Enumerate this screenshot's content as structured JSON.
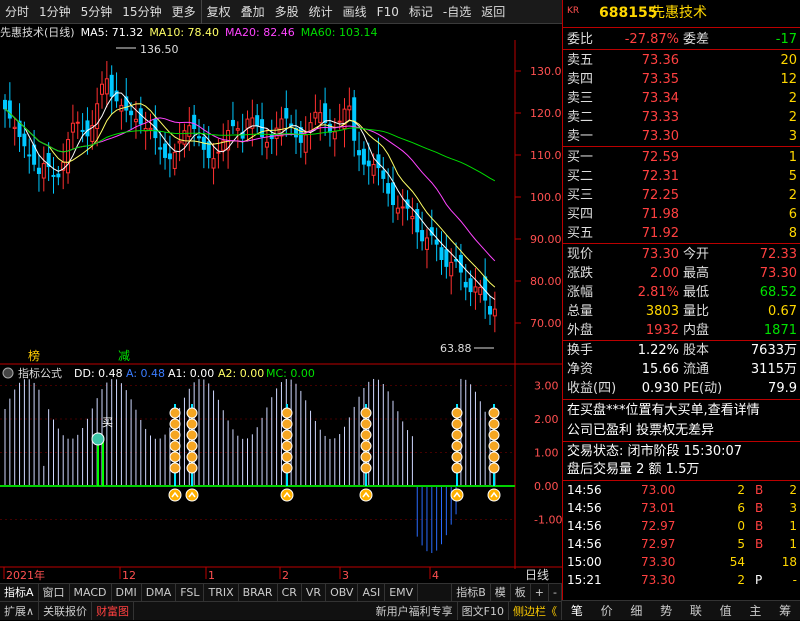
{
  "toolbar": {
    "items": [
      "分时",
      "1分钟",
      "5分钟",
      "15分钟",
      "更多",
      "复权",
      "叠加",
      "多股",
      "统计",
      "画线",
      "F10",
      "标记",
      "-自选",
      "返回"
    ]
  },
  "main_chart": {
    "title": "先惠技术(日线)",
    "ma5": "MA5: 71.32",
    "ma10": "MA10: 78.40",
    "ma20": "MA20: 82.46",
    "ma60": "MA60: 103.14",
    "high_label": "136.50",
    "low_label": "63.88",
    "y_ticks": [
      "130.0",
      "120.0",
      "110.0",
      "100.0",
      "90.00",
      "80.00",
      "70.00"
    ],
    "markers": [
      "榜",
      "减"
    ],
    "colors": {
      "up": "#ff3030",
      "down": "#00c8ff",
      "ma5": "#ffffff",
      "ma10": "#ffff66",
      "ma20": "#ff44ff",
      "ma60": "#00dd00"
    }
  },
  "indicator": {
    "name": "指标公式",
    "dd": "DD: 0.48",
    "a": "A: 0.48",
    "a1": "A1: 0.00",
    "a2": "A2: 0.00",
    "mc": "MC: 0.00",
    "y_ticks": [
      "3.00",
      "2.00",
      "1.00",
      "0.00",
      "-1.00"
    ],
    "buy_label": "买"
  },
  "x_axis": {
    "labels": [
      "2021年",
      "12",
      "1",
      "2",
      "3",
      "4"
    ],
    "period": "日线"
  },
  "bottom_tabs": [
    "指标A",
    "窗口",
    "MACD",
    "DMI",
    "DMA",
    "FSL",
    "TRIX",
    "BRAR",
    "CR",
    "VR",
    "OBV",
    "ASI",
    "EMV",
    "",
    "指标B",
    "模",
    "板",
    "+",
    "-"
  ],
  "status_bar": {
    "left": [
      "扩展∧",
      "关联报价",
      "财富图"
    ],
    "right": [
      "新用户福利专享",
      "图文F10",
      "侧边栏《"
    ]
  },
  "quote": {
    "market_tag": "KR",
    "code": "688155",
    "name": "先惠技术",
    "ratio_label": "委比",
    "ratio": "-27.87%",
    "diff_label": "委差",
    "diff": "-17",
    "asks": [
      {
        "label": "卖五",
        "price": "73.36",
        "vol": "20"
      },
      {
        "label": "卖四",
        "price": "73.35",
        "vol": "12"
      },
      {
        "label": "卖三",
        "price": "73.34",
        "vol": "2"
      },
      {
        "label": "卖二",
        "price": "73.33",
        "vol": "2"
      },
      {
        "label": "卖一",
        "price": "73.30",
        "vol": "3"
      }
    ],
    "bids": [
      {
        "label": "买一",
        "price": "72.59",
        "vol": "1"
      },
      {
        "label": "买二",
        "price": "72.31",
        "vol": "5"
      },
      {
        "label": "买三",
        "price": "72.25",
        "vol": "2"
      },
      {
        "label": "买四",
        "price": "71.98",
        "vol": "6"
      },
      {
        "label": "买五",
        "price": "71.92",
        "vol": "8"
      }
    ],
    "stats": [
      {
        "l1": "现价",
        "v1": "73.30",
        "c1": "red",
        "l2": "今开",
        "v2": "72.33",
        "c2": "red"
      },
      {
        "l1": "涨跌",
        "v1": "2.00",
        "c1": "red",
        "l2": "最高",
        "v2": "73.30",
        "c2": "red"
      },
      {
        "l1": "涨幅",
        "v1": "2.81%",
        "c1": "red",
        "l2": "最低",
        "v2": "68.52",
        "c2": "green"
      },
      {
        "l1": "总量",
        "v1": "3803",
        "c1": "yellow",
        "l2": "量比",
        "v2": "0.67",
        "c2": "yellow"
      },
      {
        "l1": "外盘",
        "v1": "1932",
        "c1": "red",
        "l2": "内盘",
        "v2": "1871",
        "c2": "green"
      }
    ],
    "stats2": [
      {
        "l1": "换手",
        "v1": "1.22%",
        "l2": "股本",
        "v2": "7633万"
      },
      {
        "l1": "净资",
        "v1": "15.66",
        "l2": "流通",
        "v2": "3115万"
      },
      {
        "l1": "收益(四)",
        "v1": "0.930",
        "l2": "PE(动)",
        "v2": "79.9"
      }
    ],
    "news": [
      "在买盘***位置有大买单,查看详情",
      "公司已盈利 投票权无差异"
    ],
    "trade_state": "交易状态: 闭市阶段 15:30:07",
    "after_hours": "盘后交易量 2 额 1.5万",
    "ticks": [
      {
        "time": "14:56",
        "price": "73.00",
        "vol": "2",
        "side": "B",
        "n": "2"
      },
      {
        "time": "14:56",
        "price": "73.01",
        "vol": "6",
        "side": "B",
        "n": "3"
      },
      {
        "time": "14:56",
        "price": "72.97",
        "vol": "0",
        "side": "B",
        "n": "1"
      },
      {
        "time": "14:56",
        "price": "72.97",
        "vol": "5",
        "side": "B",
        "n": "1"
      },
      {
        "time": "15:00",
        "price": "73.30",
        "vol": "54",
        "side": "",
        "n": "18"
      },
      {
        "time": "15:21",
        "price": "73.30",
        "vol": "2",
        "side": "P",
        "n": "-"
      }
    ],
    "tabs": [
      "笔",
      "价",
      "细",
      "势",
      "联",
      "值",
      "主",
      "筹"
    ]
  }
}
